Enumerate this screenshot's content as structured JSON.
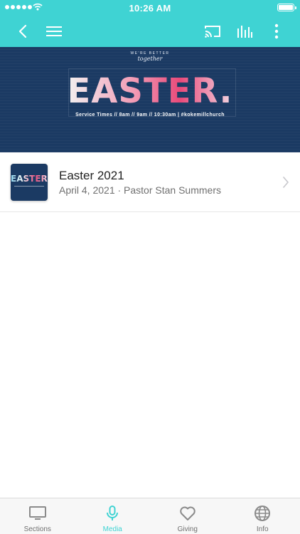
{
  "status_bar": {
    "time": "10:26 AM"
  },
  "toolbar": {
    "icons": {
      "back": "chevron-left-icon",
      "menu": "hamburger-menu-icon",
      "cast": "cast-icon",
      "audio": "audio-bars-icon",
      "more": "more-vertical-icon"
    }
  },
  "banner": {
    "tagline_top": "WE'RE BETTER",
    "tagline_script": "together",
    "title": "EASTER.",
    "subtitle": "Service Times // 8am // 9am // 10:30am | #kokemillchurch"
  },
  "media_list": [
    {
      "thumbnail_text": "EASTER.",
      "title": "Easter 2021",
      "meta": "April 4, 2021 · Pastor Stan Summers"
    }
  ],
  "tab_bar": {
    "tabs": [
      {
        "label": "Sections",
        "icon": "monitor-icon",
        "active": false
      },
      {
        "label": "Media",
        "icon": "microphone-icon",
        "active": true
      },
      {
        "label": "Giving",
        "icon": "heart-icon",
        "active": false
      },
      {
        "label": "Info",
        "icon": "globe-icon",
        "active": false
      }
    ]
  },
  "colors": {
    "accent": "#3fd3d3",
    "banner_background": "#1b3a63",
    "inactive_tab": "#707070"
  }
}
